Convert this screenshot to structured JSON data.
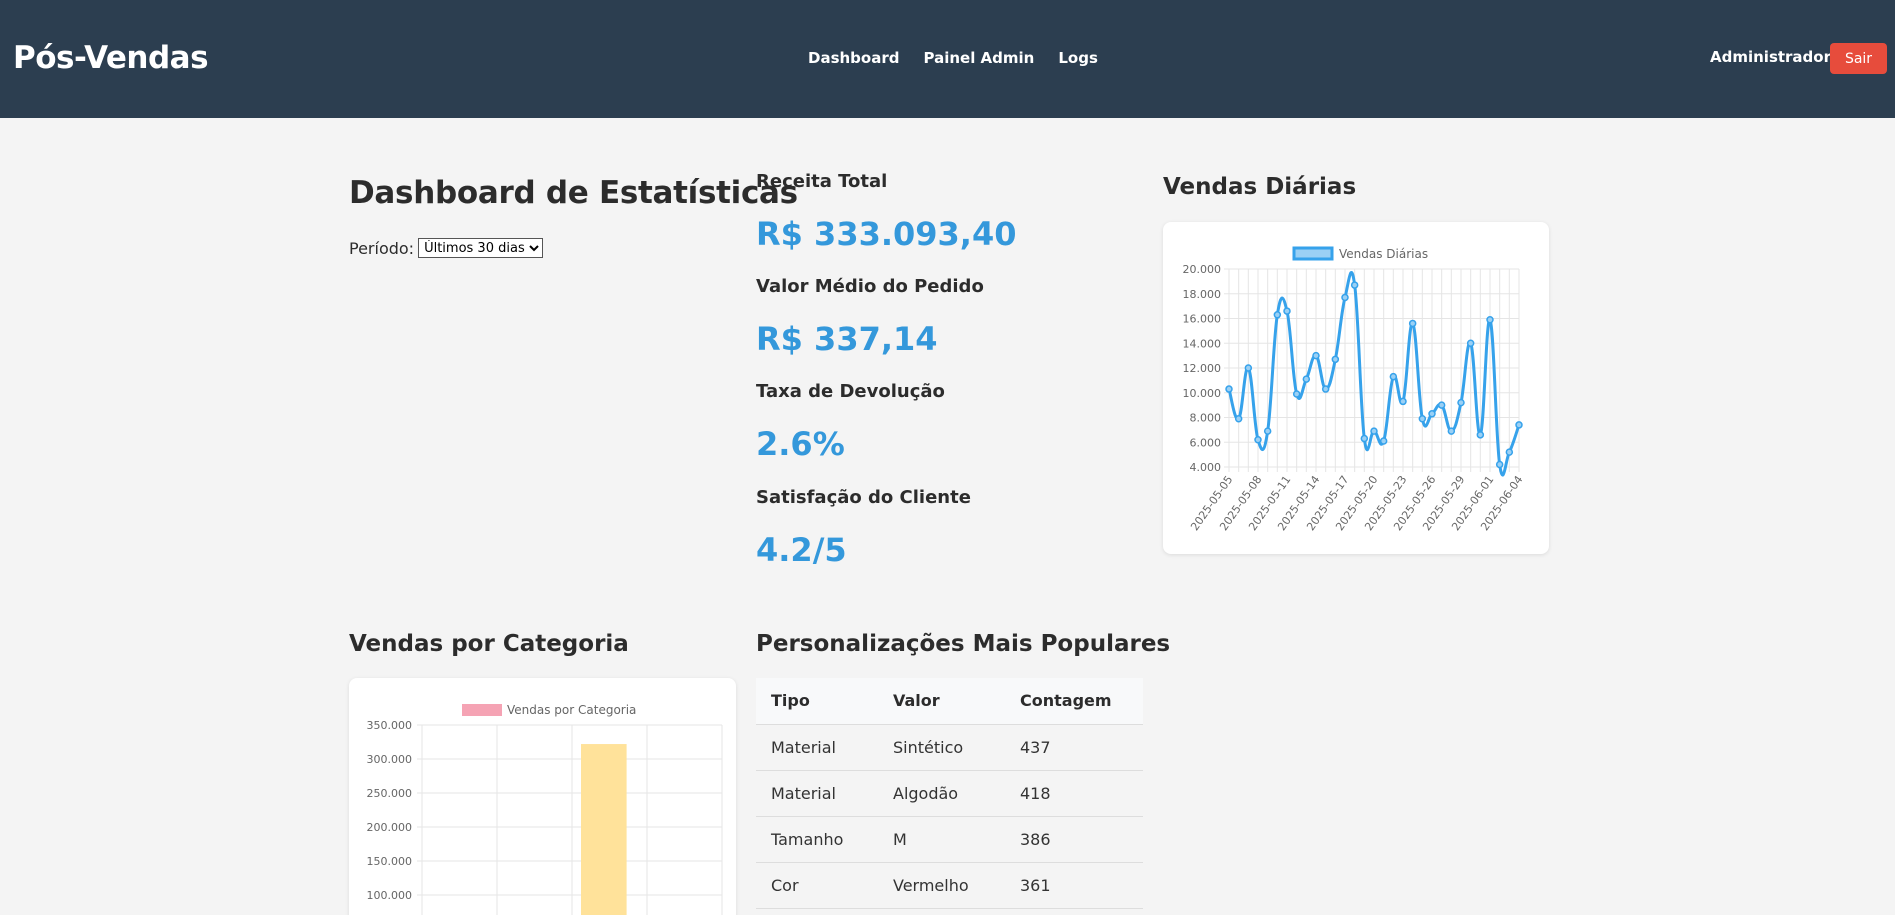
{
  "header": {
    "brand": "Pós-Vendas",
    "nav": [
      "Dashboard",
      "Painel Admin",
      "Logs"
    ],
    "user": "Administrador",
    "logout_label": "Sair",
    "bg_color": "#2c3e50",
    "logout_color": "#e74c3c"
  },
  "main": {
    "title": "Dashboard de Estatísticas",
    "period_label": "Período:",
    "period_selected": "Últimos 30 dias"
  },
  "kpis": [
    {
      "label": "Receita Total",
      "value": "R$ 333.093,40"
    },
    {
      "label": "Valor Médio do Pedido",
      "value": "R$ 337,14"
    },
    {
      "label": "Taxa de Devolução",
      "value": "2.6%"
    },
    {
      "label": "Satisfação do Cliente",
      "value": "4.2/5"
    }
  ],
  "accent_color": "#3498db",
  "daily_sales": {
    "title": "Vendas Diárias"
  },
  "category_sales": {
    "title": "Vendas por Categoria"
  },
  "popular": {
    "title": "Personalizações Mais Populares",
    "columns": [
      "Tipo",
      "Valor",
      "Contagem"
    ],
    "rows": [
      [
        "Material",
        "Sintético",
        "437"
      ],
      [
        "Material",
        "Algodão",
        "418"
      ],
      [
        "Tamanho",
        "M",
        "386"
      ],
      [
        "Cor",
        "Vermelho",
        "361"
      ]
    ]
  },
  "chart_data": [
    {
      "type": "line",
      "legend": "Vendas Diárias",
      "color": "#36a2eb",
      "x": [
        "2025-05-05",
        "2025-05-06",
        "2025-05-07",
        "2025-05-08",
        "2025-05-09",
        "2025-05-10",
        "2025-05-11",
        "2025-05-12",
        "2025-05-13",
        "2025-05-14",
        "2025-05-15",
        "2025-05-16",
        "2025-05-17",
        "2025-05-18",
        "2025-05-19",
        "2025-05-20",
        "2025-05-21",
        "2025-05-22",
        "2025-05-23",
        "2025-05-24",
        "2025-05-25",
        "2025-05-26",
        "2025-05-27",
        "2025-05-28",
        "2025-05-29",
        "2025-05-30",
        "2025-05-31",
        "2025-06-01",
        "2025-06-02",
        "2025-06-03",
        "2025-06-04"
      ],
      "values": [
        10300,
        7900,
        12000,
        6200,
        6900,
        16300,
        16600,
        9900,
        11100,
        13000,
        10300,
        12700,
        17700,
        18700,
        6300,
        6900,
        6100,
        11300,
        9300,
        15600,
        7900,
        8300,
        9000,
        6900,
        9200,
        14000,
        6600,
        15900,
        4200,
        5200,
        7400
      ],
      "x_tick_labels": [
        "2025-05-05",
        "2025-05-08",
        "2025-05-11",
        "2025-05-14",
        "2025-05-17",
        "2025-05-20",
        "2025-05-23",
        "2025-05-26",
        "2025-05-29",
        "2025-06-01",
        "2025-06-04"
      ],
      "y_ticks": [
        "20.000",
        "18.000",
        "16.000",
        "14.000",
        "12.000",
        "10.000",
        "8.000",
        "6.000",
        "4.000"
      ],
      "ylim": [
        4000,
        20000
      ],
      "grid": true,
      "legend_position": "top"
    },
    {
      "type": "bar",
      "legend": "Vendas por Categoria",
      "legend_color": "#f5a3b4",
      "bar_color": "#ffe29a",
      "categories": [
        "",
        "",
        "",
        ""
      ],
      "values": [
        0,
        0,
        322000,
        0
      ],
      "y_ticks": [
        "350.000",
        "300.000",
        "250.000",
        "200.000",
        "150.000",
        "100.000"
      ],
      "ylim": [
        0,
        350000
      ],
      "grid": true,
      "legend_position": "top"
    }
  ]
}
